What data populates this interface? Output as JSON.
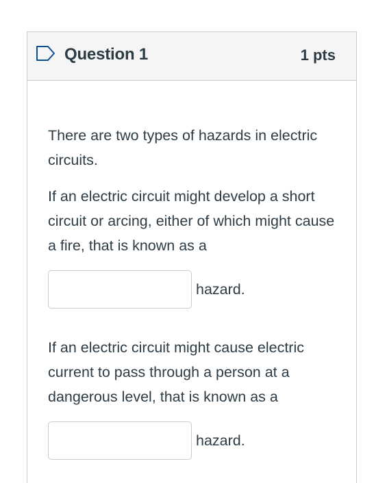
{
  "question": {
    "title": "Question 1",
    "points": "1 pts",
    "flag_icon": "flag-outline-icon"
  },
  "body": {
    "intro": "There are two types of hazards in electric circuits.",
    "prompt1": "If an electric circuit might develop a short circuit or arcing,  either of which might cause a fire, that is known as a",
    "blank1": {
      "value": "",
      "placeholder": ""
    },
    "suffix1": "hazard.",
    "prompt2": "If an electric circuit might cause electric current to pass through a person at a dangerous level, that is known as a",
    "blank2": {
      "value": "",
      "placeholder": ""
    },
    "suffix2": "hazard."
  },
  "colors": {
    "header_bg": "#f5f5f5",
    "border": "#c7cdd1",
    "text": "#2d3b45",
    "flag_stroke": "#0b4f94"
  }
}
